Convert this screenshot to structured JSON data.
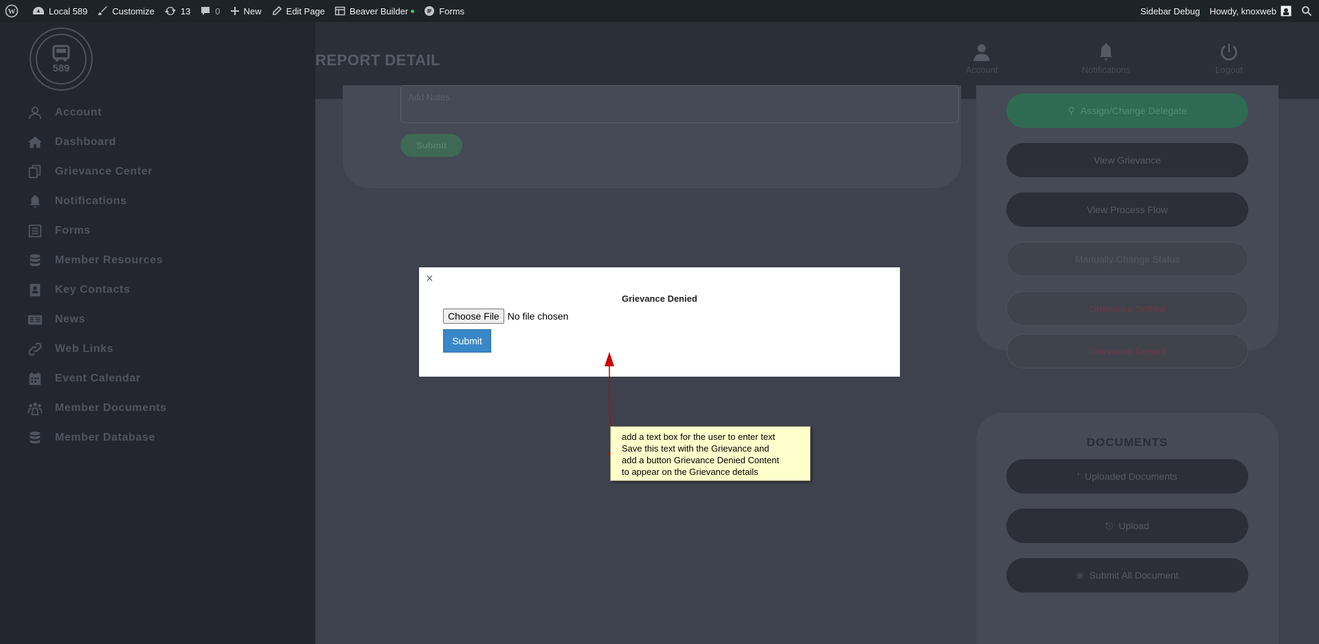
{
  "adminbar": {
    "site": "Local 589",
    "customize": "Customize",
    "updates": "13",
    "comments": "0",
    "new": "New",
    "edit_page": "Edit Page",
    "beaver_builder": "Beaver Builder",
    "forms": "Forms",
    "sidebar_debug": "Sidebar Debug",
    "howdy": "Howdy, knoxweb"
  },
  "logo": {
    "text": "589"
  },
  "sidebar": {
    "items": [
      {
        "label": "Account",
        "icon": "user-icon"
      },
      {
        "label": "Dashboard",
        "icon": "home-icon"
      },
      {
        "label": "Grievance Center",
        "icon": "copy-icon"
      },
      {
        "label": "Notifications",
        "icon": "bell-icon"
      },
      {
        "label": "Forms",
        "icon": "list-icon"
      },
      {
        "label": "Member Resources",
        "icon": "database-icon"
      },
      {
        "label": "Key Contacts",
        "icon": "contact-icon"
      },
      {
        "label": "News",
        "icon": "news-icon"
      },
      {
        "label": "Web Links",
        "icon": "link-icon"
      },
      {
        "label": "Event Calendar",
        "icon": "calendar-icon"
      },
      {
        "label": "Member Documents",
        "icon": "users-icon"
      },
      {
        "label": "Member Database",
        "icon": "database-icon"
      }
    ]
  },
  "header": {
    "title": "REPORT DETAIL",
    "icons": [
      {
        "label": "Account",
        "icon": "user-icon"
      },
      {
        "label": "Notifications",
        "icon": "bell-icon"
      },
      {
        "label": "Logout",
        "icon": "power-icon"
      }
    ]
  },
  "notes": {
    "placeholder": "Add Notes",
    "submit": "Submit"
  },
  "actions": {
    "assign": "Assign/Change Delegate",
    "view_grievance": "View Grievance",
    "view_process": "View Process Flow",
    "manual_status": "Manually Change Status",
    "settled": "Grievance Settled",
    "denied": "Grievance Denied"
  },
  "documents": {
    "title": "DOCUMENTS",
    "uploaded": "Uploaded Documents",
    "upload": "Upload",
    "submit_all": "Submit All Document"
  },
  "modal": {
    "close": "×",
    "title": "Grievance Denied",
    "choose_file": "Choose File",
    "no_file": "No file chosen",
    "submit": "Submit"
  },
  "annotation": {
    "lines": [
      "add a text box for the user to enter text",
      "Save this text with the Grievance and",
      "add a button Grievance Denied Content",
      "to appear on the Grievance details"
    ]
  },
  "colors": {
    "adminbar": "#1d2327",
    "sidebar": "#23262e",
    "submit_blue": "#3a87c8",
    "note_bg": "#ffffcc",
    "arrow_red": "#cc0000"
  }
}
